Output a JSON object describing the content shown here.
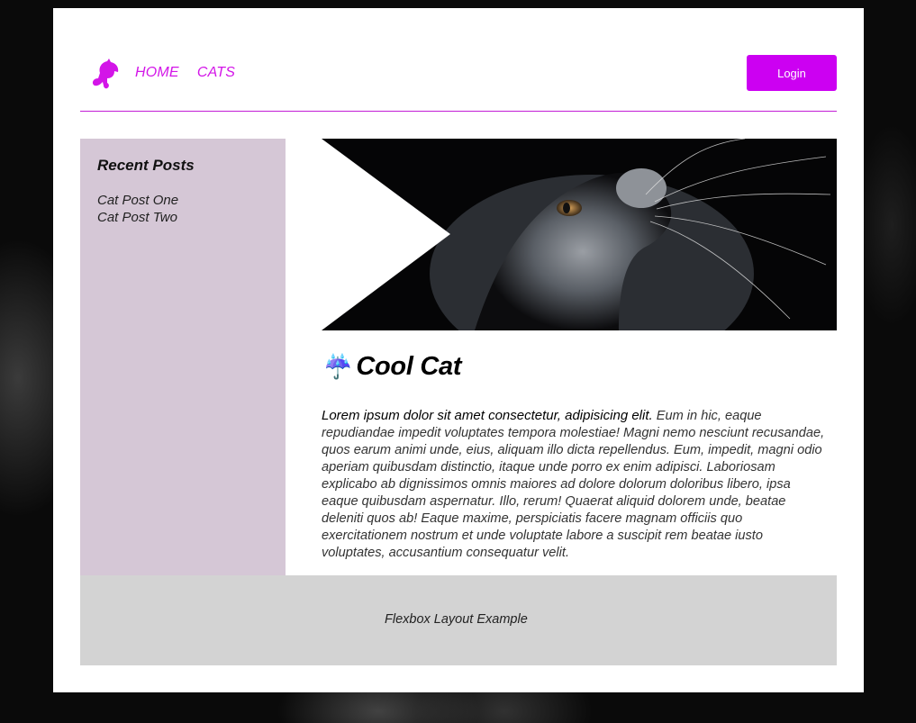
{
  "nav": {
    "items": [
      {
        "label": "HOME"
      },
      {
        "label": "CATS"
      }
    ],
    "login_label": "Login"
  },
  "sidebar": {
    "title": "Recent Posts",
    "posts": [
      {
        "label": "Cat Post One"
      },
      {
        "label": "Cat Post Two"
      }
    ]
  },
  "article": {
    "icon": "☔",
    "title": "Cool Cat",
    "lead": "Lorem ipsum dolor sit amet consectetur, adipisicing elit.",
    "body": " Eum in hic, eaque repudiandae impedit voluptates tempora molestiae! Magni nemo nesciunt recusandae, quos earum animi unde, eius, aliquam illo dicta repellendus. Eum, impedit, magni odio aperiam quibusdam distinctio, itaque unde porro ex enim adipisci. Laboriosam explicabo ab dignissimos omnis maiores ad dolore dolorum doloribus libero, ipsa eaque quibusdam aspernatur. Illo, rerum! Quaerat aliquid dolorem unde, beatae deleniti quos ab! Eaque maxime, perspiciatis facere magnam officiis quo exercitationem nostrum et unde voluptate labore a suscipit rem beatae iusto voluptates, accusantium consequatur velit."
  },
  "footer": {
    "text": "Flexbox Layout Example"
  },
  "colors": {
    "accent": "#cc00f2",
    "sidebar_bg": "#d5c7d6",
    "footer_bg": "#d3d3d3"
  },
  "icons": {
    "logo": "cat-head-logo-icon",
    "article": "umbrella-rain-icon"
  }
}
